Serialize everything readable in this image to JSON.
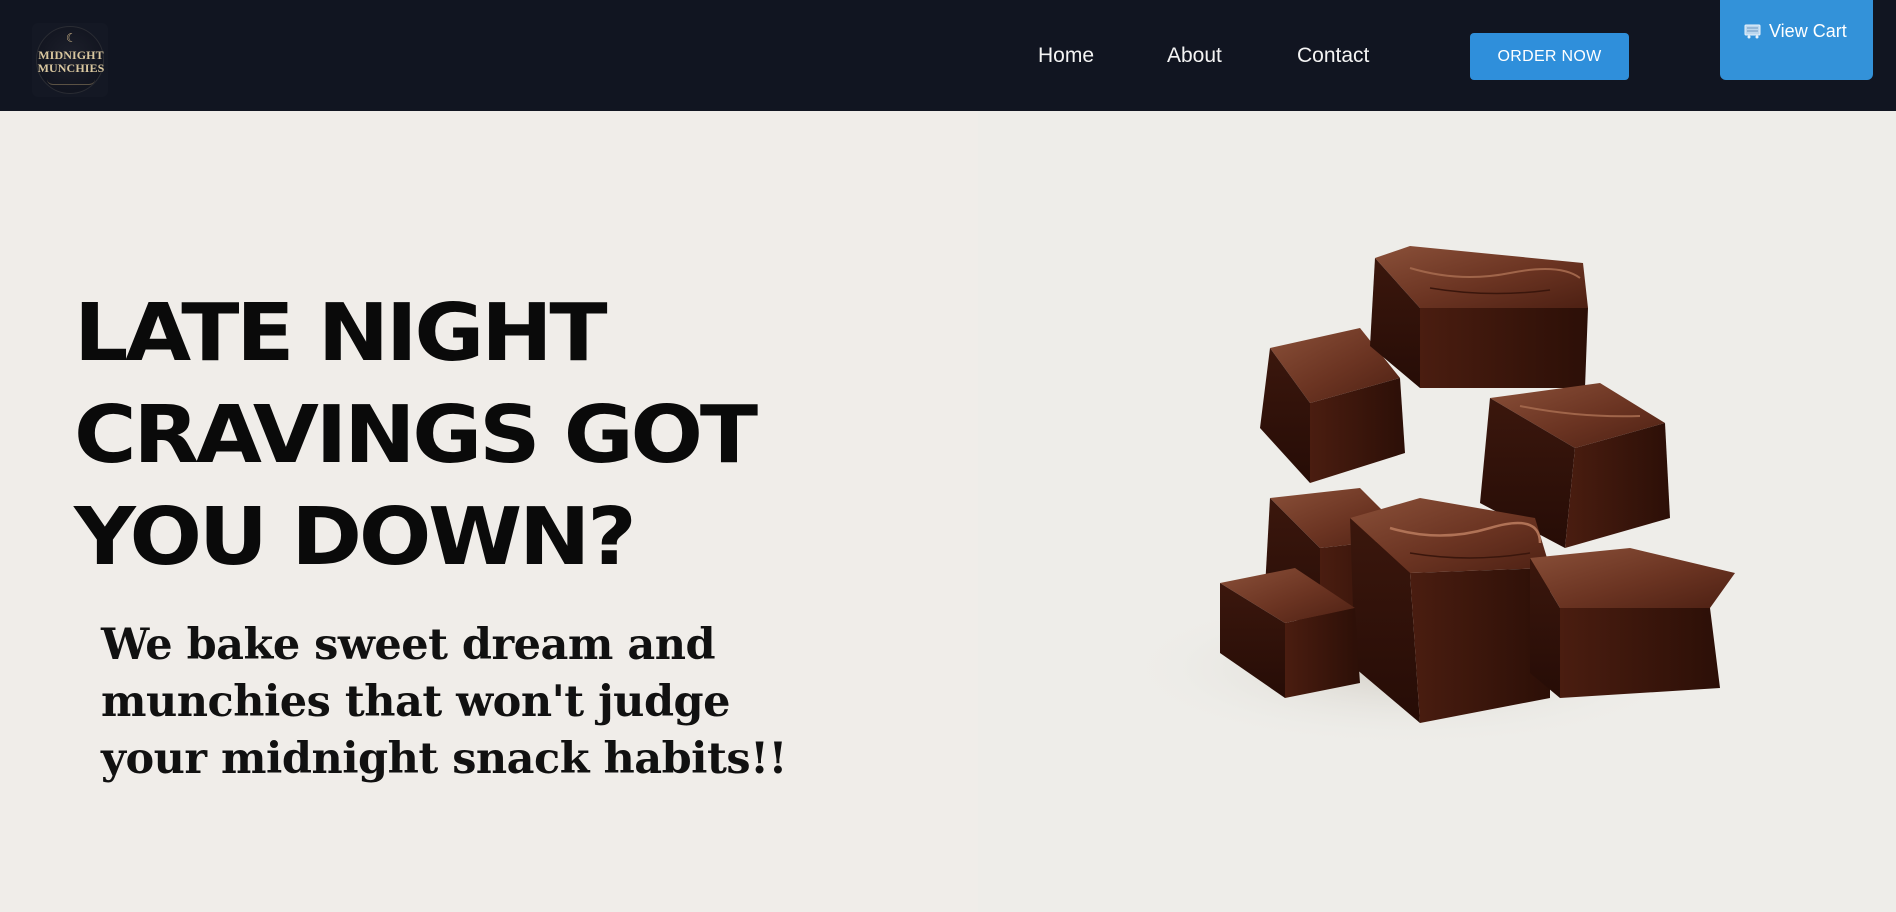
{
  "header": {
    "logo": {
      "line1": "MIDNIGHT",
      "line2": "MUNCHIES"
    },
    "nav": [
      {
        "label": "Home"
      },
      {
        "label": "About"
      },
      {
        "label": "Contact"
      }
    ],
    "order_button": "ORDER NOW",
    "cart_button": {
      "icon": "cart-icon",
      "label": "View Cart"
    }
  },
  "hero": {
    "headline_lines": [
      "LATE NIGHT",
      "CRAVINGS GOT",
      "YOU DOWN?"
    ],
    "subheadline": "We bake sweet dream and munchies that won't judge your midnight snack habits!!",
    "image": "brownie-stack-image"
  },
  "colors": {
    "nav_background": "#111521",
    "accent_blue": "#2f8fdb",
    "page_background": "#f0ede9",
    "headline_text": "#0a0a0a"
  }
}
